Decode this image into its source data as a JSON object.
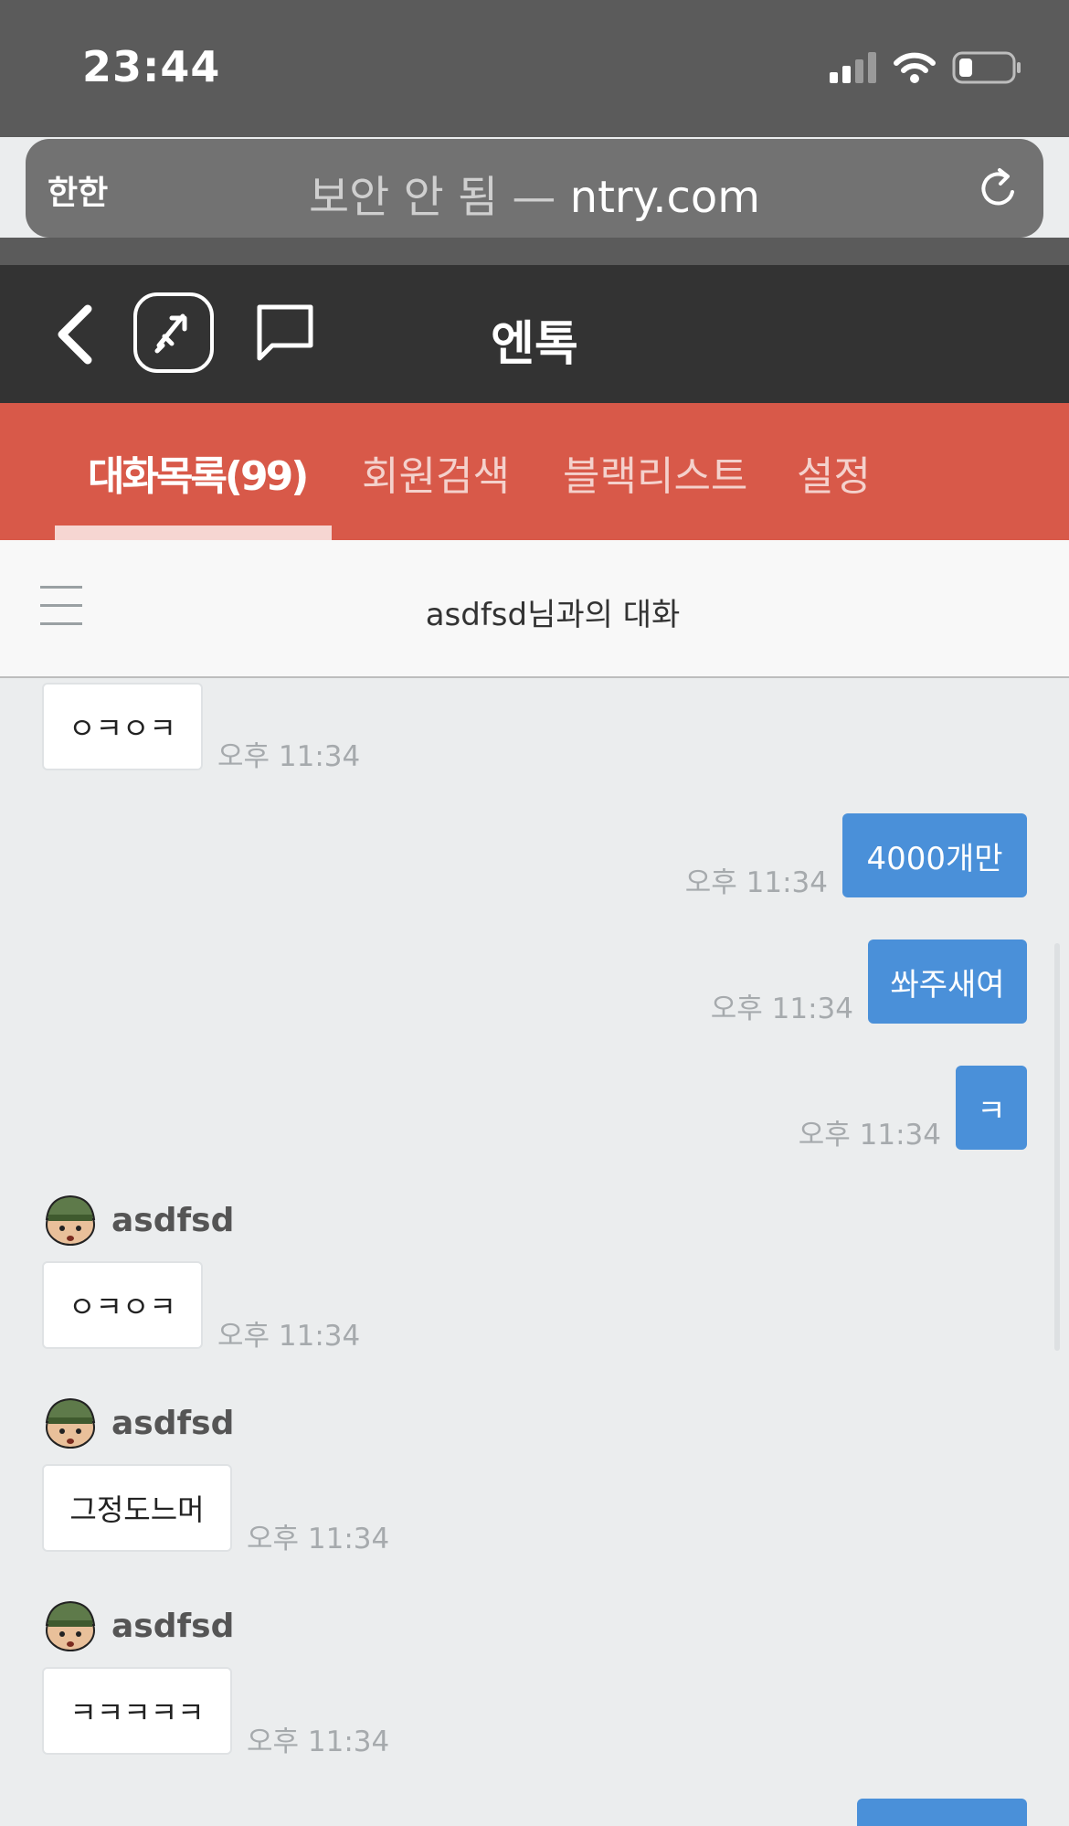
{
  "status_bar": {
    "time": "23:44"
  },
  "url_bar": {
    "aa": "한한",
    "security": "보안 안 됨",
    "separator": " — ",
    "domain": "ntry.com"
  },
  "nav": {
    "title": "엔톡"
  },
  "tabs": [
    {
      "label": "대화목록(99)",
      "active": true
    },
    {
      "label": "회원검색",
      "active": false
    },
    {
      "label": "블랙리스트",
      "active": false
    },
    {
      "label": "설정",
      "active": false
    }
  ],
  "conversation": {
    "title": "asdfsd님과의 대화"
  },
  "messages": [
    {
      "dir": "in",
      "text": "ㅇㅋㅇㅋ",
      "time": "오후 11:34"
    },
    {
      "dir": "out",
      "text": "4000개만",
      "time": "오후 11:34"
    },
    {
      "dir": "out",
      "text": "쏴주새여",
      "time": "오후 11:34"
    },
    {
      "dir": "out",
      "text": "ㅋ",
      "time": "오후 11:34"
    },
    {
      "dir": "in",
      "sender": "asdfsd",
      "text": "ㅇㅋㅇㅋ",
      "time": "오후 11:34"
    },
    {
      "dir": "in",
      "sender": "asdfsd",
      "text": "그정도느머",
      "time": "오후 11:34"
    },
    {
      "dir": "in",
      "sender": "asdfsd",
      "text": "ㅋㅋㅋㅋㅋ",
      "time": "오후 11:34"
    }
  ],
  "colors": {
    "tab_bar": "#d85949",
    "nav_bar": "#333333",
    "outgoing_bubble": "#4a90d9",
    "chat_bg": "#ebedee"
  },
  "icons": [
    "signal-icon",
    "wifi-icon",
    "battery-icon",
    "reload-icon",
    "back-icon",
    "logo-icon",
    "chat-icon",
    "hamburger-icon",
    "avatar-icon"
  ]
}
